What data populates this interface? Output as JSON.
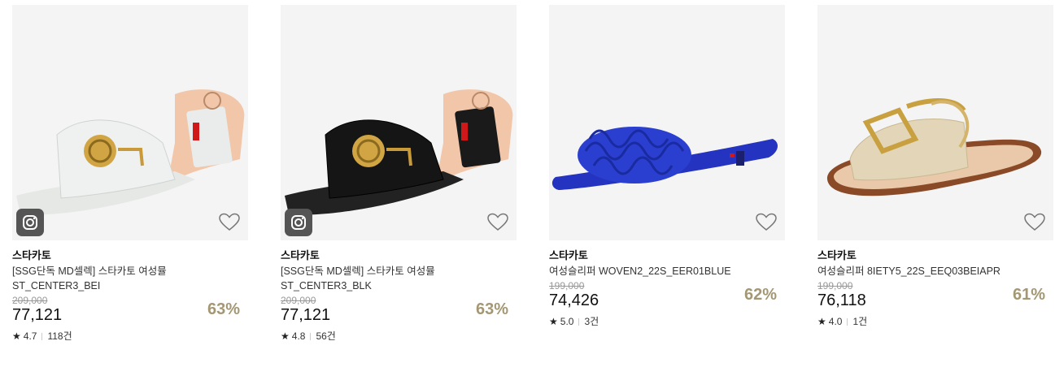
{
  "products": [
    {
      "brand": "스타카토",
      "title_line1": "[SSG단독 MD셀렉] 스타카토 여성뮬",
      "title_line2": "ST_CENTER3_BEI",
      "original_price": "209,000",
      "price": "77,121",
      "discount": "63%",
      "rating": "4.7",
      "reviews": "118건",
      "has_instagram_badge": true,
      "shoe_color": "#eef1ef"
    },
    {
      "brand": "스타카토",
      "title_line1": "[SSG단독 MD셀렉] 스타카토 여성뮬",
      "title_line2": "ST_CENTER3_BLK",
      "original_price": "209,000",
      "price": "77,121",
      "discount": "63%",
      "rating": "4.8",
      "reviews": "56건",
      "has_instagram_badge": true,
      "shoe_color": "#151515"
    },
    {
      "brand": "스타카토",
      "title_line1": "여성슬리퍼 WOVEN2_22S_EER01BLUE",
      "title_line2": "",
      "original_price": "199,000",
      "price": "74,426",
      "discount": "62%",
      "rating": "5.0",
      "reviews": "3건",
      "has_instagram_badge": false,
      "shoe_color": "#2a3fd0"
    },
    {
      "brand": "스타카토",
      "title_line1": "여성슬리퍼 8IETY5_22S_EEQ03BEIAPR",
      "title_line2": "",
      "original_price": "199,000",
      "price": "76,118",
      "discount": "61%",
      "rating": "4.0",
      "reviews": "1건",
      "has_instagram_badge": false,
      "shoe_color": "#e3d6b8"
    }
  ]
}
